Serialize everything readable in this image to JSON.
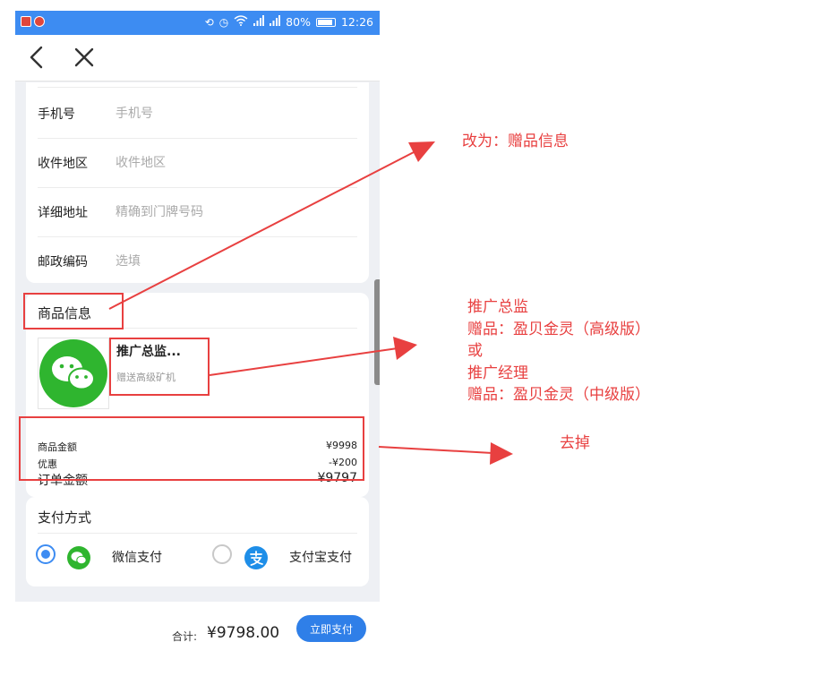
{
  "status_bar": {
    "battery_percent": "80%",
    "time": "12:26",
    "icons": [
      "app-icon",
      "app-icon",
      "rotate-icon",
      "alarm-icon",
      "wifi-icon",
      "signal-icon",
      "signal-icon",
      "battery-icon"
    ]
  },
  "nav": {
    "back_icon": "chevron-left-icon",
    "close_icon": "close-icon"
  },
  "form": {
    "rows": [
      {
        "label": "手机号",
        "placeholder": "手机号"
      },
      {
        "label": "收件地区",
        "placeholder": "收件地区"
      },
      {
        "label": "详细地址",
        "placeholder": "精确到门牌号码"
      },
      {
        "label": "邮政编码",
        "placeholder": "选填"
      }
    ]
  },
  "goods": {
    "title": "商品信息",
    "product_name": "推广总监...",
    "product_sub": "赠送高级矿机",
    "image_icon": "wechat-logo-icon",
    "summary": {
      "amount_label": "商品金额",
      "amount_value": "¥9998",
      "discount_label": "优惠",
      "discount_value": "-¥200",
      "order_label": "订单金额",
      "order_value": "¥9797"
    }
  },
  "payment": {
    "title": "支付方式",
    "options": [
      {
        "label": "微信支付",
        "icon": "wechat-pay-icon",
        "selected": true
      },
      {
        "label": "支付宝支付",
        "icon": "alipay-icon",
        "selected": false
      }
    ]
  },
  "bottom": {
    "total_label": "合计:",
    "total_value": "¥9798.00",
    "pay_button": "立即支付"
  },
  "annotations": {
    "note1": "改为：赠品信息",
    "note2": "推广总监\n赠品：盈贝金灵（高级版）\n或\n推广经理\n赠品：盈贝金灵（中级版）",
    "note3": "去掉",
    "color": "#e84040"
  },
  "colors": {
    "accent": "#3d8cf2",
    "pay_button": "#2f7fe8",
    "wechat_green": "#2fb52f",
    "annotation_red": "#e84040"
  }
}
